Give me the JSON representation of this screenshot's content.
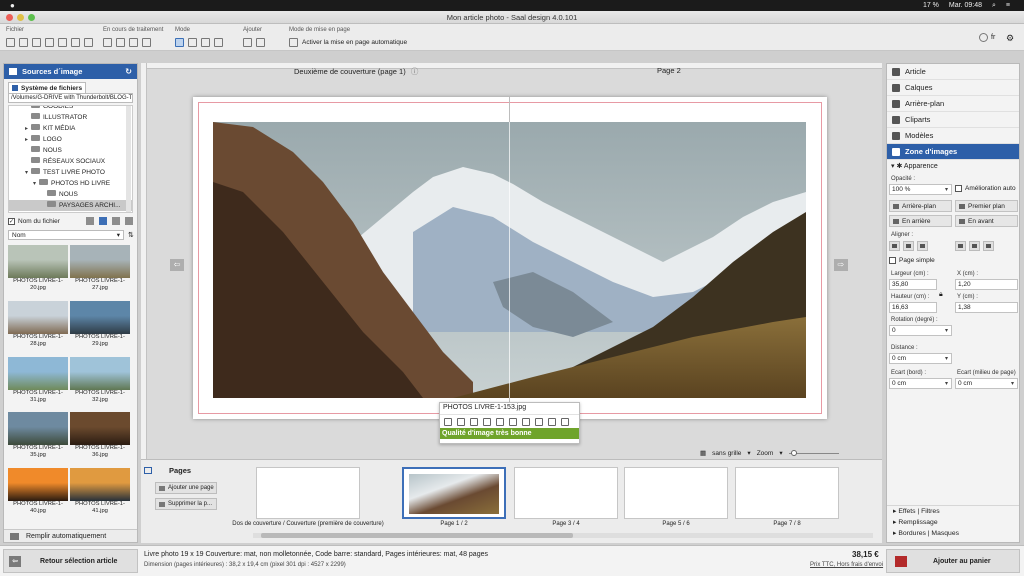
{
  "menubar": {
    "apple": "",
    "battery": "17 %",
    "clock": "Mar. 09:48"
  },
  "window": {
    "title": "Mon article photo - Saal design 4.0.101"
  },
  "toolbar": {
    "groups": {
      "file": "Fichier",
      "processing": "En cours de traitement",
      "mode": "Mode",
      "add": "Ajouter",
      "layout_mode": "Mode de mise en page"
    },
    "auto_layout_label": "Activer la mise en page automatique",
    "lang": "fr"
  },
  "left_panel": {
    "title": "Sources d´image",
    "tab": "Système de fichiers",
    "path": "/Volumes/G-DRIVE with Thunderbolt/BLOG-TRO",
    "tree": [
      {
        "label": "GOODIES",
        "depth": 2,
        "arrow": ""
      },
      {
        "label": "ILLUSTRATOR",
        "depth": 2,
        "arrow": ""
      },
      {
        "label": "KIT MÉDIA",
        "depth": 2,
        "arrow": "▸"
      },
      {
        "label": "LOGO",
        "depth": 2,
        "arrow": "▸"
      },
      {
        "label": "NOUS",
        "depth": 2,
        "arrow": ""
      },
      {
        "label": "RÉSEAUX SOCIAUX",
        "depth": 2,
        "arrow": ""
      },
      {
        "label": "TEST LIVRE PHOTO",
        "depth": 2,
        "arrow": "▾"
      },
      {
        "label": "PHOTOS HD LIVRE",
        "depth": 3,
        "arrow": "▾"
      },
      {
        "label": "NOUS",
        "depth": 4,
        "arrow": ""
      },
      {
        "label": "PAYSAGES ARCHI...",
        "depth": 4,
        "arrow": "",
        "selected": true
      }
    ],
    "show_filename": "Nom du fichier",
    "sort": "Nom",
    "thumbnails": [
      {
        "caption": "PHOTOS LIVRE-1-20.jpg",
        "c1": "#b9c4b8",
        "c2": "#6d7a5a"
      },
      {
        "caption": "PHOTOS LIVRE-1-27.jpg",
        "c1": "#a7b3b8",
        "c2": "#80724d"
      },
      {
        "caption": "PHOTOS LIVRE-1-28.jpg",
        "c1": "#c9d2d9",
        "c2": "#7f6a52"
      },
      {
        "caption": "PHOTOS LIVRE-1-29.jpg",
        "c1": "#5d86a8",
        "c2": "#2e3b45"
      },
      {
        "caption": "PHOTOS LIVRE-1-31.jpg",
        "c1": "#8eb8d6",
        "c2": "#6f8a5a"
      },
      {
        "caption": "PHOTOS LIVRE-1-32.jpg",
        "c1": "#9fc3d9",
        "c2": "#5f7752"
      },
      {
        "caption": "PHOTOS LIVRE-1-35.jpg",
        "c1": "#6e8aa0",
        "c2": "#3d4a3a"
      },
      {
        "caption": "PHOTOS LIVRE-1-36.jpg",
        "c1": "#6b4a2e",
        "c2": "#2b1c12"
      },
      {
        "caption": "PHOTOS LIVRE-1-40.jpg",
        "c1": "#f08a2a",
        "c2": "#2a1a10"
      },
      {
        "caption": "PHOTOS LIVRE-1-41.jpg",
        "c1": "#e09a40",
        "c2": "#26303a"
      }
    ],
    "footer": "Remplir automatiquement"
  },
  "canvas": {
    "left_page_label": "Deuxième de couverture (page 1)",
    "right_page_label": "Page 2",
    "grid": "sans grille",
    "zoom": "Zoom"
  },
  "context_popup": {
    "filename": "PHOTOS LIVRE-1-153.jpg",
    "quality": "Qualité d'image très bonne"
  },
  "pages": {
    "title": "Pages",
    "add_page": "Ajouter une page",
    "delete_page": "Supprimer la p...",
    "thumbs": [
      {
        "caption": "Dos de couverture / Couverture (première de couverture)",
        "selected": false
      },
      {
        "caption": "Page 1 / 2",
        "selected": true
      },
      {
        "caption": "Page 3 / 4",
        "selected": false
      },
      {
        "caption": "Page 5 / 6",
        "selected": false
      },
      {
        "caption": "Page 7 / 8",
        "selected": false
      }
    ]
  },
  "right_panel": {
    "nav": [
      "Article",
      "Calques",
      "Arrière-plan",
      "Cliparts",
      "Modèles",
      "Zone d'images"
    ],
    "appearance": "Apparence",
    "opacity_label": "Opacité :",
    "opacity_value": "100 %",
    "enhance": "Amélioration auto",
    "btn_background": "Arrière-plan",
    "btn_foreground": "Premier plan",
    "btn_back": "En arrière",
    "btn_forward": "En avant",
    "align_label": "Aligner :",
    "single_page": "Page simple",
    "width_label": "Largeur (cm) :",
    "width_value": "35,80",
    "x_label": "X (cm) :",
    "x_value": "1,20",
    "height_label": "Hauteur (cm) :",
    "height_value": "16,63",
    "y_label": "Y (cm) :",
    "y_value": "1,38",
    "rotation_label": "Rotation (degré) :",
    "rotation_value": "0",
    "distance_label": "Distance :",
    "distance_value": "0 cm",
    "gap_edge_label": "Ecart (bord) :",
    "gap_edge_value": "0 cm",
    "gap_middle_label": "Ecart (milieu de page) :",
    "gap_middle_value": "0 cm",
    "footer_effects": "Effets | Filtres",
    "footer_fill": "Remplissage",
    "footer_borders": "Bordures | Masques"
  },
  "bottom": {
    "back_button": "Retour sélection article",
    "summary": "Livre photo 19 x 19 Couverture: mat, non molletonnée, Code barre: standard, Pages intérieures: mat, 48 pages",
    "dimensions": "Dimension (pages intérieures) : 38,2 x 19,4 cm (pixel 301 dpi : 4527 x 2299)",
    "price": "38,15 €",
    "price_note": "Prix TTC, Hors frais d'envoi",
    "cart_button": "Ajouter au panier"
  },
  "colors": {
    "accent": "#2d5fa8",
    "quality": "#6fa42b"
  }
}
